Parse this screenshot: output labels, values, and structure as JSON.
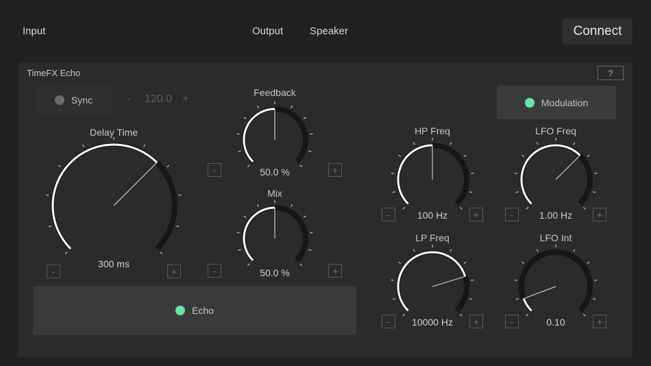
{
  "nav": {
    "input": "Input",
    "output": "Output",
    "speaker": "Speaker",
    "connect": "Connect"
  },
  "panel": {
    "title": "TimeFX Echo",
    "help": "?"
  },
  "sync": {
    "label": "Sync",
    "on": false,
    "color": "#6a6a6a",
    "tempo": "120.0",
    "minus": "-",
    "plus": "+"
  },
  "modulation": {
    "label": "Modulation",
    "on": true,
    "color": "#66e6a6"
  },
  "echo": {
    "label": "Echo",
    "on": true,
    "color": "#66e6a6"
  },
  "knobs": [
    {
      "id": "delay-time",
      "label": "Delay Time",
      "value": "300 ms",
      "fraction": 0.667,
      "minus": "-",
      "plus": "+"
    },
    {
      "id": "feedback",
      "label": "Feedback",
      "value": "50.0 %",
      "fraction": 0.5,
      "minus": "-",
      "plus": "+"
    },
    {
      "id": "mix",
      "label": "Mix",
      "value": "50.0 %",
      "fraction": 0.5,
      "minus": "-",
      "plus": "+"
    },
    {
      "id": "hp-freq",
      "label": "HP Freq",
      "value": "100 Hz",
      "fraction": 0.5,
      "minus": "-",
      "plus": "+"
    },
    {
      "id": "lfo-freq",
      "label": "LFO Freq",
      "value": "1.00 Hz",
      "fraction": 0.667,
      "minus": "-",
      "plus": "+"
    },
    {
      "id": "lp-freq",
      "label": "LP Freq",
      "value": "10000 Hz",
      "fraction": 0.77,
      "minus": "-",
      "plus": "+"
    },
    {
      "id": "lfo-int",
      "label": "LFO Int",
      "value": "0.10",
      "fraction": 0.09,
      "minus": "-",
      "plus": "+"
    }
  ]
}
